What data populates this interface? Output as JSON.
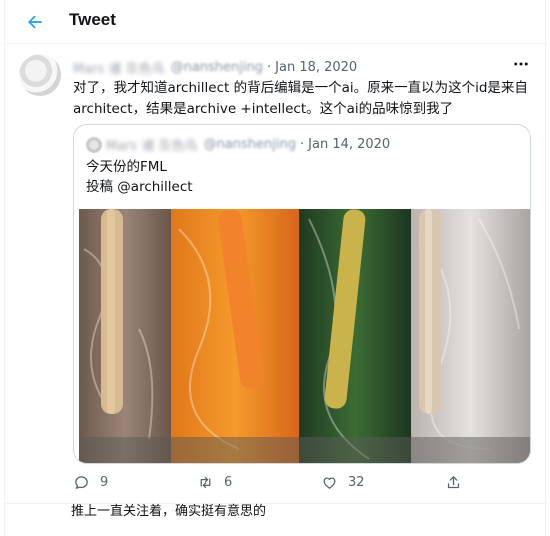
{
  "header": {
    "title": "Tweet",
    "back_icon": "arrow-left-icon"
  },
  "tweet": {
    "author_name": "Mars 诸 灰色鸟",
    "handle": "@nanshenjing",
    "date": "Jan 18, 2020",
    "text_line1": "对了，我才知道archillect 的背后编辑是一个ai。原来一直以为这个id是来自",
    "text_line2": "architect，结果是archive +intellect。这个ai的品味惊到我了",
    "quote": {
      "author_name": "Mars 诸 灰色鸟",
      "handle": "@nanshenjing",
      "date": "Jan 14, 2020",
      "text_line1": "今天份的FML",
      "text_line2": "投稿 @archillect",
      "image": "popsicle-bags-photo"
    },
    "actions": {
      "reply_count": "9",
      "retweet_count": "6",
      "like_count": "32"
    }
  },
  "reply": {
    "text": "推上一直关注着，确实挺有意思的"
  },
  "colors": {
    "accent": "#1d9bf0",
    "muted": "#536471",
    "border": "#eff3f4"
  }
}
